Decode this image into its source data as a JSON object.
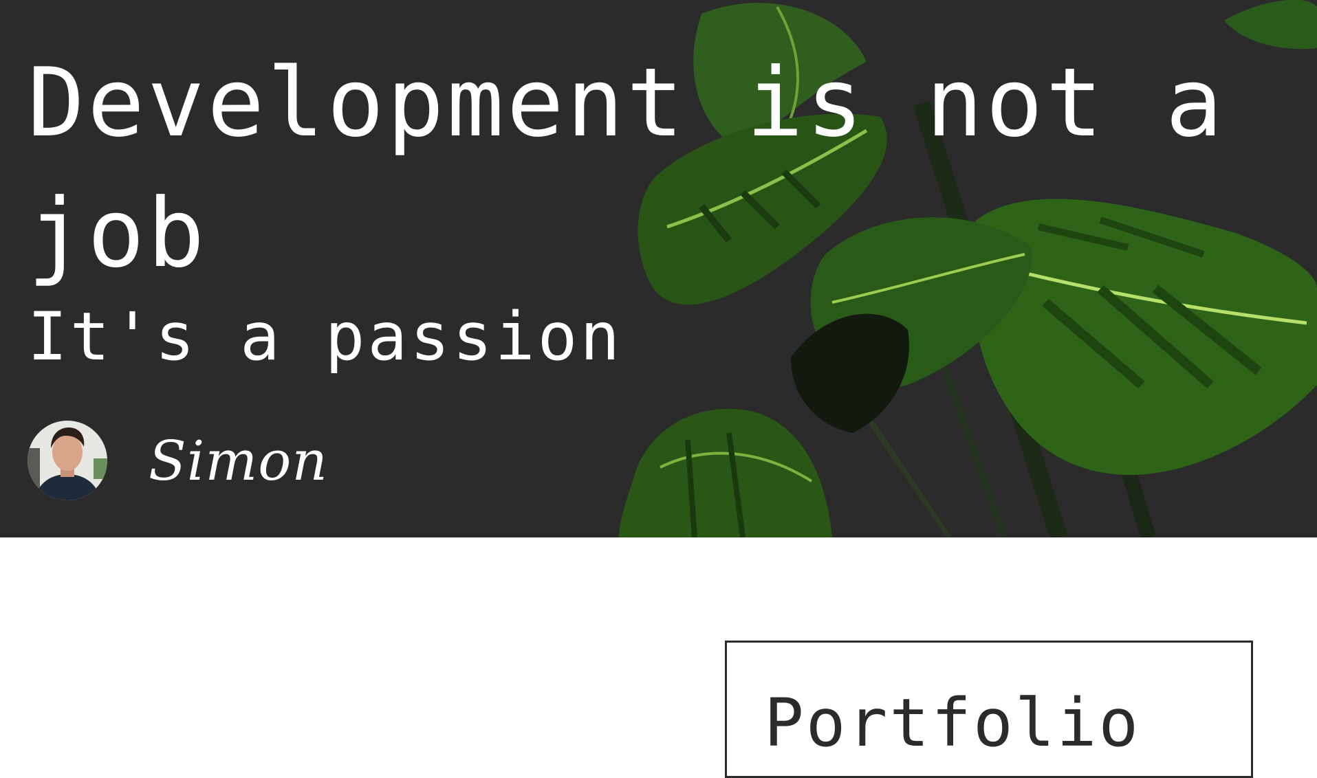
{
  "hero": {
    "headline": "Development is not a job",
    "subline": "It's a passion",
    "author_name": "Simon",
    "background_color": "#2b2b2b",
    "text_color": "#ffffff",
    "decoration": "monstera-plant-illustration"
  },
  "portfolio": {
    "title": "Portfolio"
  }
}
